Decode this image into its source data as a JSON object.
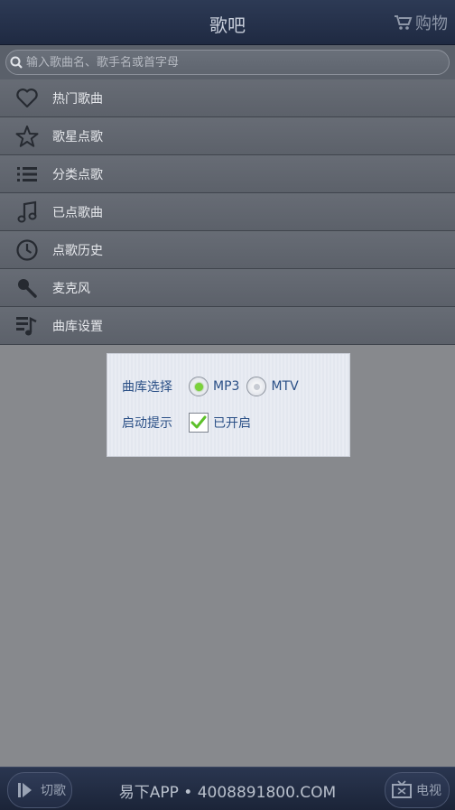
{
  "header": {
    "title": "歌吧",
    "shop_label": "购物"
  },
  "search": {
    "placeholder": "输入歌曲名、歌手名或首字母"
  },
  "menu": {
    "items": [
      {
        "label": "热门歌曲",
        "icon": "heart-icon"
      },
      {
        "label": "歌星点歌",
        "icon": "star-icon"
      },
      {
        "label": "分类点歌",
        "icon": "list-icon"
      },
      {
        "label": "已点歌曲",
        "icon": "music-note-icon"
      },
      {
        "label": "点歌历史",
        "icon": "clock-icon"
      },
      {
        "label": "麦克风",
        "icon": "microphone-icon"
      },
      {
        "label": "曲库设置",
        "icon": "library-settings-icon"
      }
    ]
  },
  "dialog": {
    "library_label": "曲库选择",
    "option_mp3": "MP3",
    "option_mtv": "MTV",
    "selected": "MP3",
    "startup_label": "启动提示",
    "startup_value": "已开启",
    "startup_checked": true
  },
  "footer": {
    "skip_label": "切歌",
    "center_text": "易下APP • 4008891800.COM",
    "tv_label": "电视"
  },
  "colors": {
    "accent_green": "#7bd23a",
    "dialog_text": "#2a4f86"
  }
}
